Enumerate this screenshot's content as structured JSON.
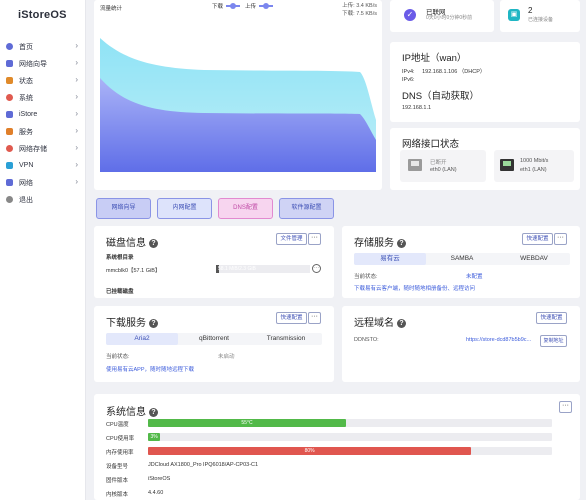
{
  "app": {
    "logo": "iStoreOS"
  },
  "sidebar": {
    "items": [
      {
        "label": "首页",
        "icon": "home-icon",
        "has_arrow": true
      },
      {
        "label": "网络向导",
        "icon": "globe-icon",
        "has_arrow": true
      },
      {
        "label": "状态",
        "icon": "grid-icon",
        "has_arrow": true
      },
      {
        "label": "系统",
        "icon": "gear-icon",
        "has_arrow": true
      },
      {
        "label": "iStore",
        "icon": "store-icon",
        "has_arrow": true
      },
      {
        "label": "服务",
        "icon": "apps-icon",
        "has_arrow": true
      },
      {
        "label": "网络存储",
        "icon": "storage-icon",
        "has_arrow": true
      },
      {
        "label": "VPN",
        "icon": "vpn-icon",
        "has_arrow": true
      },
      {
        "label": "网络",
        "icon": "network-icon",
        "has_arrow": true
      },
      {
        "label": "退出",
        "icon": "logout-icon",
        "has_arrow": false
      }
    ]
  },
  "traffic": {
    "title": "流量统计",
    "legend_down": "下载",
    "legend_up": "上传",
    "up_rate": "上传: 3.4 KB/s",
    "down_rate": "下载: 7.5 KB/s"
  },
  "status_cards": {
    "connected_label": "已联网",
    "connected_sub": "0天0小时0分钟0秒前",
    "devices_count": "2",
    "devices_label": "已连接设备"
  },
  "quick_buttons": [
    "网络向导",
    "内网配置",
    "DNS配置",
    "软件源配置"
  ],
  "ip_card": {
    "title": "IP地址（wan）",
    "ipv4_label": "IPv4:",
    "ipv4_value": "192.168.1.106 （DHCP）",
    "ipv6_label": "IPv6:",
    "dns_title": "DNS（自动获取）",
    "dns_value": "192.168.1.1"
  },
  "net_ports": {
    "title": "网络接口状态",
    "ports": [
      {
        "status": "已断开",
        "name": "eth0 (LAN)"
      },
      {
        "status": "1000 Mbit/s",
        "name": "eth1 (LAN)"
      }
    ]
  },
  "disk": {
    "title": "磁盘信息",
    "file_manage_label": "文件管理",
    "more_label": "···",
    "system_root_label": "系统根目录",
    "device_name": "mmcblk0【57.1 GiB】",
    "usage_text": "58.1 MiB/2.3 GiB",
    "usage_fraction": 0.03,
    "mounted_label": "已挂载磁盘"
  },
  "storage": {
    "title": "存储服务",
    "quick_config_label": "快速配置",
    "more_label": "···",
    "tabs": [
      "易有云",
      "SAMBA",
      "WEBDAV"
    ],
    "status_label": "当前状态:",
    "status_value": "未配置",
    "note": "下载易有云客户端，随时随地相册备份、远程访问"
  },
  "download": {
    "title": "下载服务",
    "quick_config_label": "快速配置",
    "more_label": "···",
    "tabs": [
      "Aria2",
      "qBittorrent",
      "Transmission"
    ],
    "status_label": "当前状态:",
    "status_value": "未启动",
    "note": "使用易有云APP，随时随地远程下载"
  },
  "remote": {
    "title": "远程域名",
    "quick_config_label": "快速配置",
    "ddnsto_label": "DDNSTO:",
    "ddnsto_link": "https://store-dcd87b5b9c...",
    "copy_label": "复制地址"
  },
  "sysinfo": {
    "title": "系统信息",
    "more_label": "···",
    "rows": [
      {
        "label": "CPU温度",
        "bar": true,
        "value_text": "55°C",
        "fraction": 0.49,
        "color": "#52b949"
      },
      {
        "label": "CPU使用率",
        "bar": true,
        "value_text": "3%",
        "fraction": 0.03,
        "color": "#52b949"
      },
      {
        "label": "内存使用率",
        "bar": true,
        "value_text": "80%",
        "fraction": 0.8,
        "color": "#e0564f"
      },
      {
        "label": "设备型号",
        "bar": false,
        "value_text": "JDCloud AX1800_Pro IPQ6018/AP-CP03-C1"
      },
      {
        "label": "固件版本",
        "bar": false,
        "value_text": "iStoreOS"
      },
      {
        "label": "内核版本",
        "bar": false,
        "value_text": "4.4.60"
      }
    ]
  },
  "colors": {
    "accent": "#3b5bdb",
    "chart_down": "#7ed7ee",
    "chart_up": "#7b86ee",
    "green": "#52b949",
    "red": "#e0564f",
    "quick_btn_bg": "#c8cdf5",
    "dns_btn_bg": "#f7d5ef"
  }
}
